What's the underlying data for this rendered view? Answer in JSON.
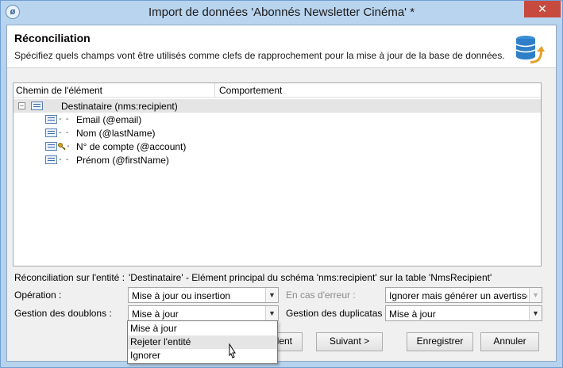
{
  "window": {
    "title": "Import de données 'Abonnés Newsletter Cinéma' *",
    "app_icon": "ø",
    "close_icon": "✕"
  },
  "header": {
    "title": "Réconciliation",
    "description": "Spécifiez quels champs vont être utilisés comme clefs de rapprochement pour la mise à jour de la base de données."
  },
  "tree": {
    "columns": [
      "Chemin de l'élément",
      "Comportement"
    ],
    "root": {
      "label": "Destinataire (nms:recipient)",
      "expander": "−"
    },
    "children": [
      {
        "label": "Email (@email)",
        "key": false
      },
      {
        "label": "Nom (@lastName)",
        "key": false
      },
      {
        "label": "N° de compte (@account)",
        "key": true
      },
      {
        "label": "Prénom (@firstName)",
        "key": false
      }
    ]
  },
  "form": {
    "entity_label": "Réconciliation sur l'entité :",
    "entity_value": "'Destinataire' - Elément principal du schéma 'nms:recipient' sur la table 'NmsRecipient'",
    "operation_label": "Opération :",
    "operation_value": "Mise à jour ou insertion",
    "error_label": "En cas d'erreur :",
    "error_value": "Ignorer mais générer un avertisse",
    "doublons_label": "Gestion des doublons :",
    "doublons_value": "Mise à jour",
    "duplicatas_label": "Gestion des duplicatas :",
    "duplicatas_value": "Mise à jour"
  },
  "dropdown": {
    "options": [
      "Mise à jour",
      "Rejeter l'entité",
      "Ignorer"
    ],
    "hovered_index": 1
  },
  "buttons": {
    "previous": "dent",
    "next": "Suivant >",
    "save": "Enregistrer",
    "cancel": "Annuler"
  }
}
